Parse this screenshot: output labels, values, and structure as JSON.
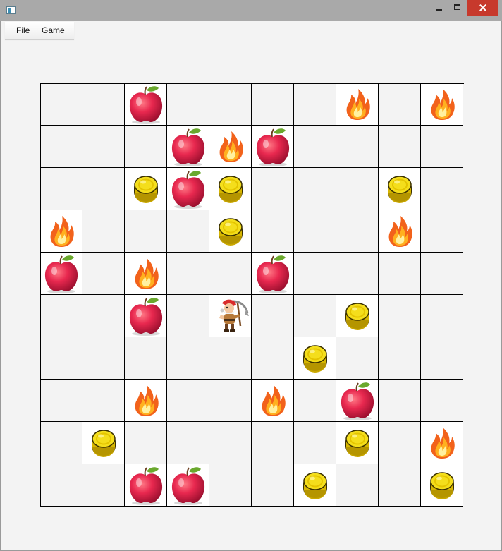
{
  "window": {
    "title": ""
  },
  "menu": {
    "file_label": "File",
    "game_label": "Game"
  },
  "board": {
    "rows": 10,
    "cols": 10,
    "cells": [
      [
        "empty",
        "empty",
        "apple",
        "empty",
        "empty",
        "empty",
        "empty",
        "fire",
        "empty",
        "fire"
      ],
      [
        "empty",
        "empty",
        "empty",
        "apple",
        "fire",
        "apple",
        "empty",
        "empty",
        "empty",
        "empty"
      ],
      [
        "empty",
        "empty",
        "coin",
        "apple",
        "coin",
        "empty",
        "empty",
        "empty",
        "coin",
        "empty"
      ],
      [
        "fire",
        "empty",
        "empty",
        "empty",
        "coin",
        "empty",
        "empty",
        "empty",
        "fire",
        "empty"
      ],
      [
        "apple",
        "empty",
        "fire",
        "empty",
        "empty",
        "apple",
        "empty",
        "empty",
        "empty",
        "empty"
      ],
      [
        "empty",
        "empty",
        "apple",
        "empty",
        "player",
        "empty",
        "empty",
        "coin",
        "empty",
        "empty"
      ],
      [
        "empty",
        "empty",
        "empty",
        "empty",
        "empty",
        "empty",
        "coin",
        "empty",
        "empty",
        "empty"
      ],
      [
        "empty",
        "empty",
        "fire",
        "empty",
        "empty",
        "fire",
        "empty",
        "apple",
        "empty",
        "empty"
      ],
      [
        "empty",
        "coin",
        "empty",
        "empty",
        "empty",
        "empty",
        "empty",
        "coin",
        "empty",
        "fire"
      ],
      [
        "empty",
        "empty",
        "apple",
        "apple",
        "empty",
        "empty",
        "coin",
        "empty",
        "empty",
        "coin"
      ]
    ]
  },
  "icons": {
    "apple": "apple-icon",
    "coin": "coin-icon",
    "fire": "fire-icon",
    "player": "dwarf-miner-icon"
  },
  "colors": {
    "apple": "#e8284f",
    "coin": "#f4de1c",
    "fire": "#f2621b",
    "grid_line": "#000000",
    "cell_background": "#f3f3f3",
    "close_button": "#c7392c"
  }
}
